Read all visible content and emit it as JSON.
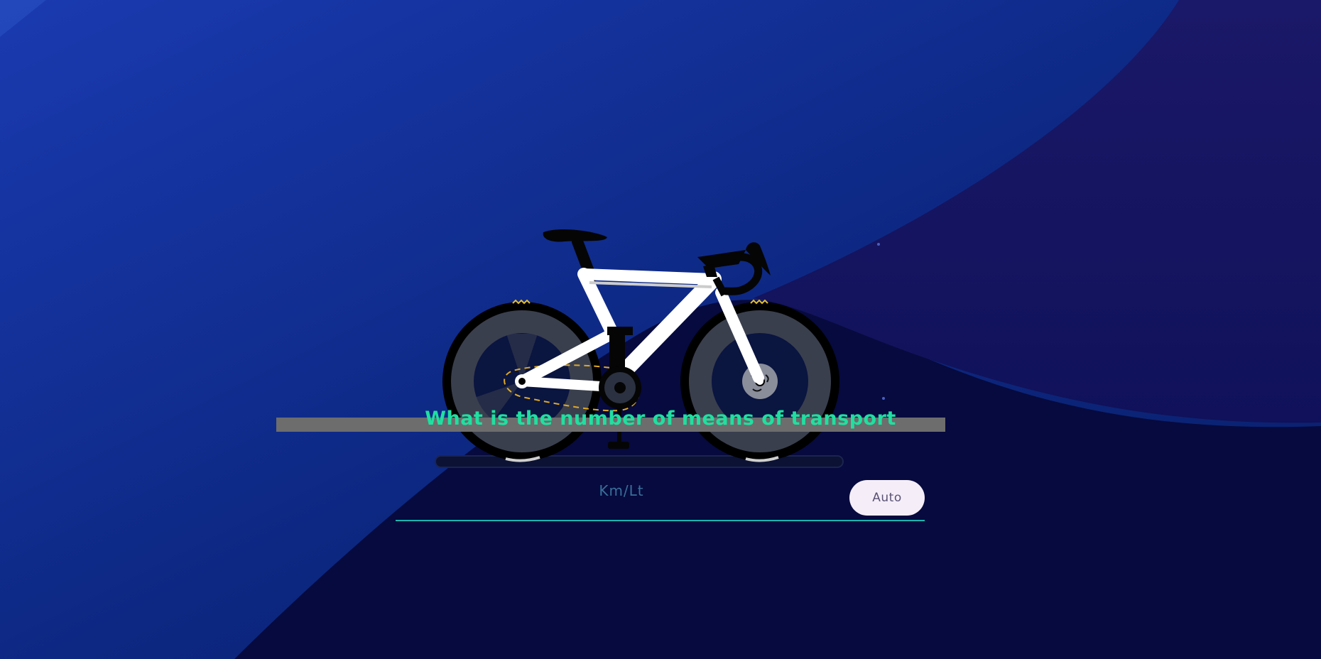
{
  "question": {
    "text": "What is the number of means of transport"
  },
  "efficiency_input": {
    "value": "",
    "placeholder": "Km/Lt"
  },
  "auto_button": {
    "label": "Auto"
  },
  "colors": {
    "background_dark": "#060a3e",
    "background_blue": "#1a3aa8",
    "question_text": "#1fe0a0",
    "input_underline": "#18b6b0",
    "button_bg": "#f5eef8",
    "chain": "#e0a922"
  },
  "illustration": {
    "icon": "racing-bicycle-icon"
  }
}
